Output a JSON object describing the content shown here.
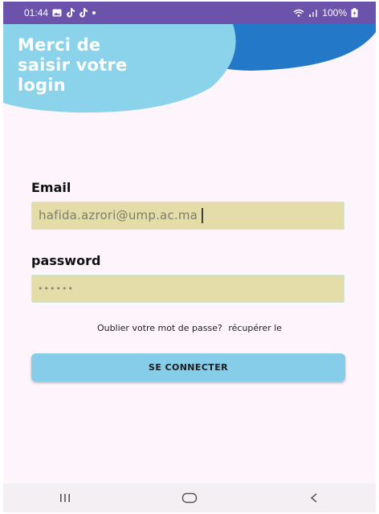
{
  "status_bar": {
    "time": "01:44",
    "battery": "100%",
    "icons_left": [
      "gallery-icon",
      "tiktok-icon",
      "tiktok-icon",
      "dot-icon"
    ],
    "icons_right": [
      "wifi-icon",
      "signal-icon",
      "battery-icon"
    ]
  },
  "header": {
    "title": "Merci de\nsaisir votre\nlogin",
    "colors": {
      "light_blue": "#8ad3ea",
      "dark_blue": "#2478c8",
      "background": "#fdf5fb"
    }
  },
  "form": {
    "email": {
      "label": "Email",
      "value": "hafida.azrori@ump.ac.ma"
    },
    "password": {
      "label": "password",
      "value": "••••••"
    },
    "forgot_text": "Oublier votre mot de passe?",
    "recover_link": "récupérer le",
    "submit_label": "SE CONNECTER",
    "colors": {
      "field_bg": "#e4dca9",
      "button_bg": "#85cde9"
    }
  },
  "nav_bar": {
    "buttons": [
      "recents-icon",
      "home-icon",
      "back-icon"
    ]
  }
}
